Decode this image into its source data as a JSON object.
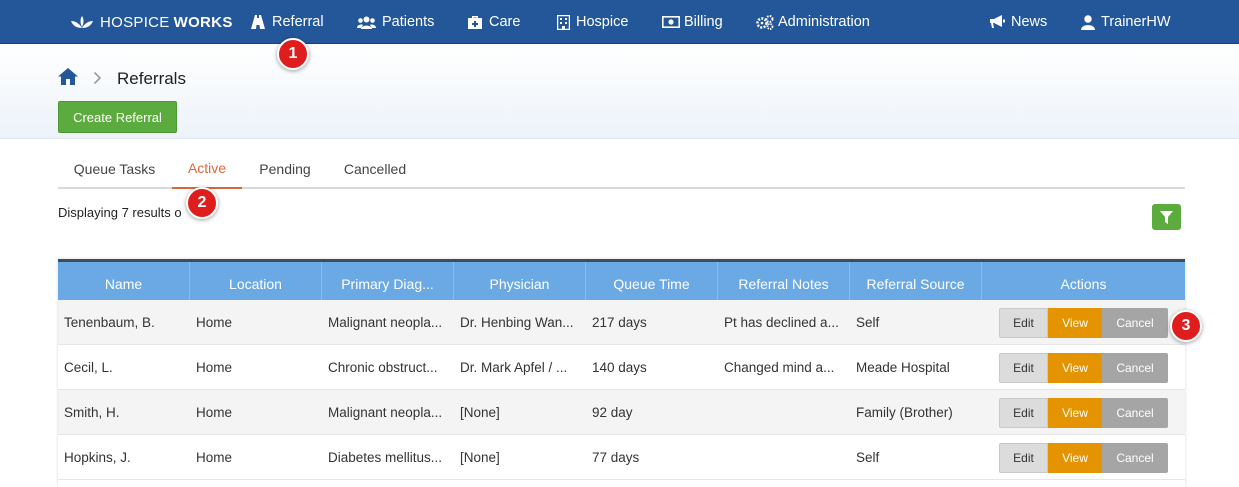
{
  "nav": {
    "brand_part1": "HOSPICE",
    "brand_part2": "WORKS",
    "items": [
      {
        "label": "Referral",
        "icon": "road-icon"
      },
      {
        "label": "Patients",
        "icon": "users-icon"
      },
      {
        "label": "Care",
        "icon": "medkit-icon"
      },
      {
        "label": "Hospice",
        "icon": "building-icon"
      },
      {
        "label": "Billing",
        "icon": "money-icon"
      },
      {
        "label": "Administration",
        "icon": "gears-icon"
      }
    ],
    "news": "News",
    "user": "TrainerHW"
  },
  "breadcrumb": {
    "title": "Referrals"
  },
  "create_button": "Create Referral",
  "tabs": [
    "Queue Tasks",
    "Active",
    "Pending",
    "Cancelled"
  ],
  "active_tab": "Active",
  "results_text": "Displaying 7 results o",
  "table": {
    "columns": [
      "Name",
      "Location",
      "Primary Diag...",
      "Physician",
      "Queue Time",
      "Referral Notes",
      "Referral Source",
      "Actions"
    ],
    "rows": [
      {
        "name": "Tenenbaum, B.",
        "location": "Home",
        "diagnosis": "Malignant neopla...",
        "physician": "Dr. Henbing Wan...",
        "queue_time": "217 days",
        "notes": "Pt has declined a...",
        "source": "Self"
      },
      {
        "name": "Cecil, L.",
        "location": "Home",
        "diagnosis": "Chronic obstruct...",
        "physician": "Dr. Mark Apfel / ...",
        "queue_time": "140 days",
        "notes": "Changed mind a...",
        "source": "Meade Hospital"
      },
      {
        "name": "Smith, H.",
        "location": "Home",
        "diagnosis": "Malignant neopla...",
        "physician": "[None]",
        "queue_time": "92 day",
        "notes": "",
        "source": "Family (Brother)"
      },
      {
        "name": "Hopkins, J.",
        "location": "Home",
        "diagnosis": "Diabetes mellitus...",
        "physician": "[None]",
        "queue_time": "77 days",
        "notes": "",
        "source": "Self"
      }
    ],
    "actions": {
      "edit": "Edit",
      "view": "View",
      "cancel": "Cancel"
    }
  },
  "markers": [
    "1",
    "2",
    "3"
  ],
  "colors": {
    "nav": "#23579a",
    "green": "#5cab3e",
    "header": "#6aa9e3",
    "view": "#e39400",
    "active_tab": "#d9673c",
    "marker": "#e01d1d"
  }
}
